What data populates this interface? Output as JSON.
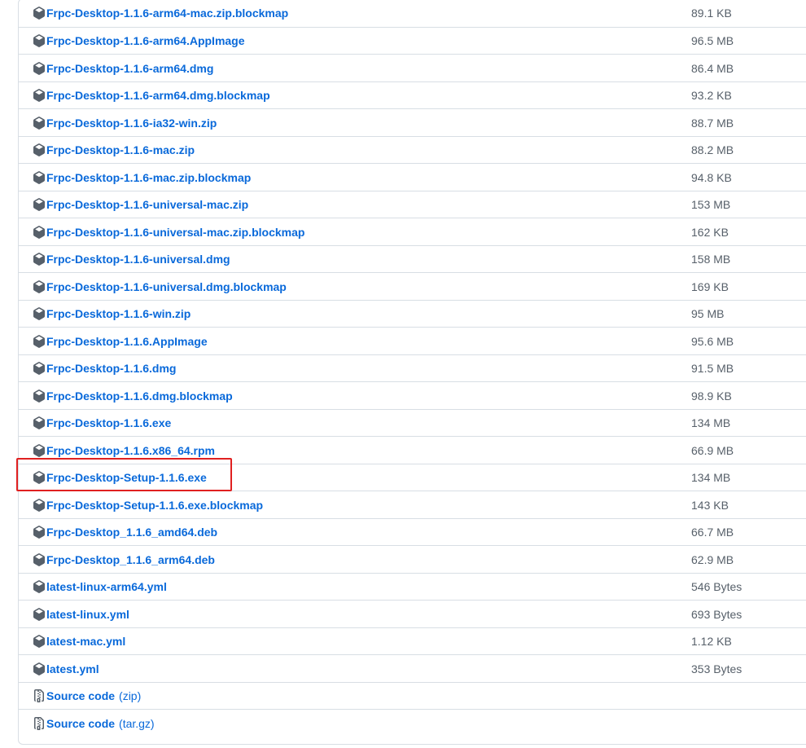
{
  "assets": [
    {
      "name": "Frpc-Desktop-1.1.6-arm64-mac.zip.blockmap",
      "size": "89.1 KB",
      "icon": "package-icon"
    },
    {
      "name": "Frpc-Desktop-1.1.6-arm64.AppImage",
      "size": "96.5 MB",
      "icon": "package-icon"
    },
    {
      "name": "Frpc-Desktop-1.1.6-arm64.dmg",
      "size": "86.4 MB",
      "icon": "package-icon"
    },
    {
      "name": "Frpc-Desktop-1.1.6-arm64.dmg.blockmap",
      "size": "93.2 KB",
      "icon": "package-icon"
    },
    {
      "name": "Frpc-Desktop-1.1.6-ia32-win.zip",
      "size": "88.7 MB",
      "icon": "package-icon"
    },
    {
      "name": "Frpc-Desktop-1.1.6-mac.zip",
      "size": "88.2 MB",
      "icon": "package-icon"
    },
    {
      "name": "Frpc-Desktop-1.1.6-mac.zip.blockmap",
      "size": "94.8 KB",
      "icon": "package-icon"
    },
    {
      "name": "Frpc-Desktop-1.1.6-universal-mac.zip",
      "size": "153 MB",
      "icon": "package-icon"
    },
    {
      "name": "Frpc-Desktop-1.1.6-universal-mac.zip.blockmap",
      "size": "162 KB",
      "icon": "package-icon"
    },
    {
      "name": "Frpc-Desktop-1.1.6-universal.dmg",
      "size": "158 MB",
      "icon": "package-icon"
    },
    {
      "name": "Frpc-Desktop-1.1.6-universal.dmg.blockmap",
      "size": "169 KB",
      "icon": "package-icon"
    },
    {
      "name": "Frpc-Desktop-1.1.6-win.zip",
      "size": "95 MB",
      "icon": "package-icon"
    },
    {
      "name": "Frpc-Desktop-1.1.6.AppImage",
      "size": "95.6 MB",
      "icon": "package-icon"
    },
    {
      "name": "Frpc-Desktop-1.1.6.dmg",
      "size": "91.5 MB",
      "icon": "package-icon"
    },
    {
      "name": "Frpc-Desktop-1.1.6.dmg.blockmap",
      "size": "98.9 KB",
      "icon": "package-icon"
    },
    {
      "name": "Frpc-Desktop-1.1.6.exe",
      "size": "134 MB",
      "icon": "package-icon"
    },
    {
      "name": "Frpc-Desktop-1.1.6.x86_64.rpm",
      "size": "66.9 MB",
      "icon": "package-icon"
    },
    {
      "name": "Frpc-Desktop-Setup-1.1.6.exe",
      "size": "134 MB",
      "icon": "package-icon",
      "highlighted": true
    },
    {
      "name": "Frpc-Desktop-Setup-1.1.6.exe.blockmap",
      "size": "143 KB",
      "icon": "package-icon"
    },
    {
      "name": "Frpc-Desktop_1.1.6_amd64.deb",
      "size": "66.7 MB",
      "icon": "package-icon"
    },
    {
      "name": "Frpc-Desktop_1.1.6_arm64.deb",
      "size": "62.9 MB",
      "icon": "package-icon"
    },
    {
      "name": "latest-linux-arm64.yml",
      "size": "546 Bytes",
      "icon": "package-icon"
    },
    {
      "name": "latest-linux.yml",
      "size": "693 Bytes",
      "icon": "package-icon"
    },
    {
      "name": "latest-mac.yml",
      "size": "1.12 KB",
      "icon": "package-icon"
    },
    {
      "name": "latest.yml",
      "size": "353 Bytes",
      "icon": "package-icon"
    }
  ],
  "source_code": [
    {
      "label": "Source code",
      "format": "(zip)",
      "icon": "file-zip-icon"
    },
    {
      "label": "Source code",
      "format": "(tar.gz)",
      "icon": "file-zip-icon"
    }
  ],
  "colors": {
    "link": "#0969da",
    "size_text": "#57606a",
    "border": "#d8dee4",
    "highlight": "#e02020"
  }
}
